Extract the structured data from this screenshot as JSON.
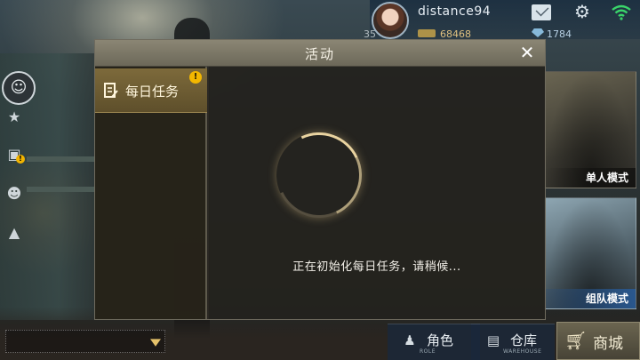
{
  "player": {
    "username": "distance94",
    "currency_left": "35",
    "gold": "68468",
    "gems": "1784"
  },
  "dialog": {
    "title": "活动",
    "close_symbol": "✕",
    "tabs": [
      {
        "label": "每日任务",
        "alert": "!"
      }
    ],
    "loading_text": "正在初始化每日任务，请稍候..."
  },
  "modes": {
    "solo": "单人模式",
    "team": "组队模式"
  },
  "bottom_nav": {
    "role": {
      "label": "角色",
      "sub": "ROLE"
    },
    "warehouse": {
      "label": "仓库",
      "sub": "WAREHOUSE"
    },
    "shop": {
      "label": "商城"
    }
  },
  "side_alert": "!",
  "icons": [
    "avatar",
    "mail-icon",
    "gear-icon",
    "wifi-icon",
    "chat-face-icon",
    "star-icon",
    "gift-icon",
    "friends-icon",
    "bell-icon",
    "person-icon",
    "box-icon",
    "cart-icon",
    "task-list-icon",
    "close-icon"
  ],
  "colors": {
    "accent_gold": "#f3b700",
    "wifi_green": "#3ad46a",
    "team_blue": "#2a5a96"
  }
}
